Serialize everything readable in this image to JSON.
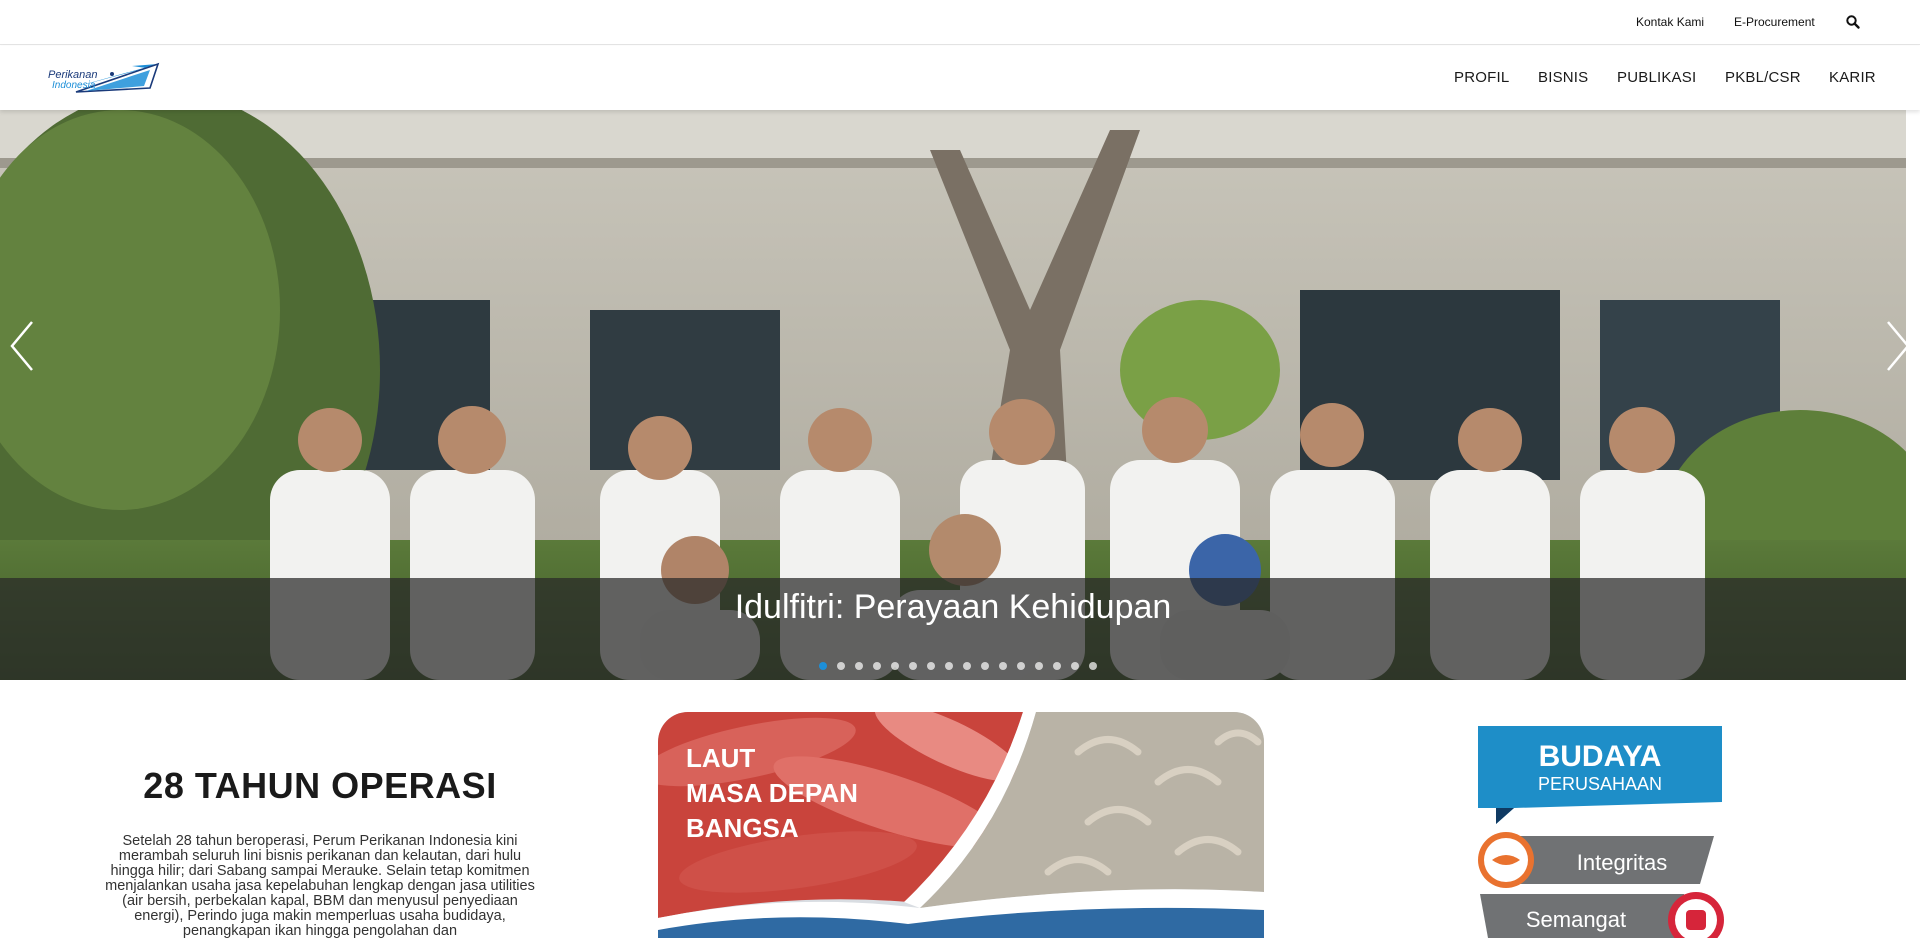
{
  "topbar": {
    "kontak": "Kontak Kami",
    "eprocurement": "E-Procurement",
    "search_icon": "search-icon"
  },
  "brand": {
    "logo_line1": "Perikanan",
    "logo_line2": "Indonesia",
    "colors": {
      "primary": "#1d8fd8",
      "dark": "#1a3a7a"
    }
  },
  "nav": {
    "items": [
      "PROFIL",
      "BISNIS",
      "PUBLIKASI",
      "PKBL/CSR",
      "KARIR"
    ]
  },
  "hero": {
    "caption": "Idulfitri: Perayaan Kehidupan",
    "slide_count": 16,
    "active_slide": 1
  },
  "info": {
    "title": "28 TAHUN OPERASI",
    "text": "Setelah 28 tahun beroperasi, Perum Perikanan Indonesia kini merambah seluruh lini bisnis perikanan dan kelautan, dari hulu hingga hilir; dari Sabang sampai Merauke. Selain tetap komitmen menjalankan usaha jasa kepelabuhan lengkap dengan jasa utilities (air bersih, perbekalan kapal, BBM dan menyusul penyediaan energi), Perindo juga makin memperluas usaha budidaya, penangkapan ikan hingga pengolahan dan"
  },
  "promo": {
    "line1": "LAUT",
    "line2": "MASA DEPAN",
    "line3": "BANGSA"
  },
  "culture": {
    "title": "BUDAYA",
    "subtitle": "PERUSAHAAN",
    "values": [
      "Integritas",
      "Semangat"
    ]
  }
}
